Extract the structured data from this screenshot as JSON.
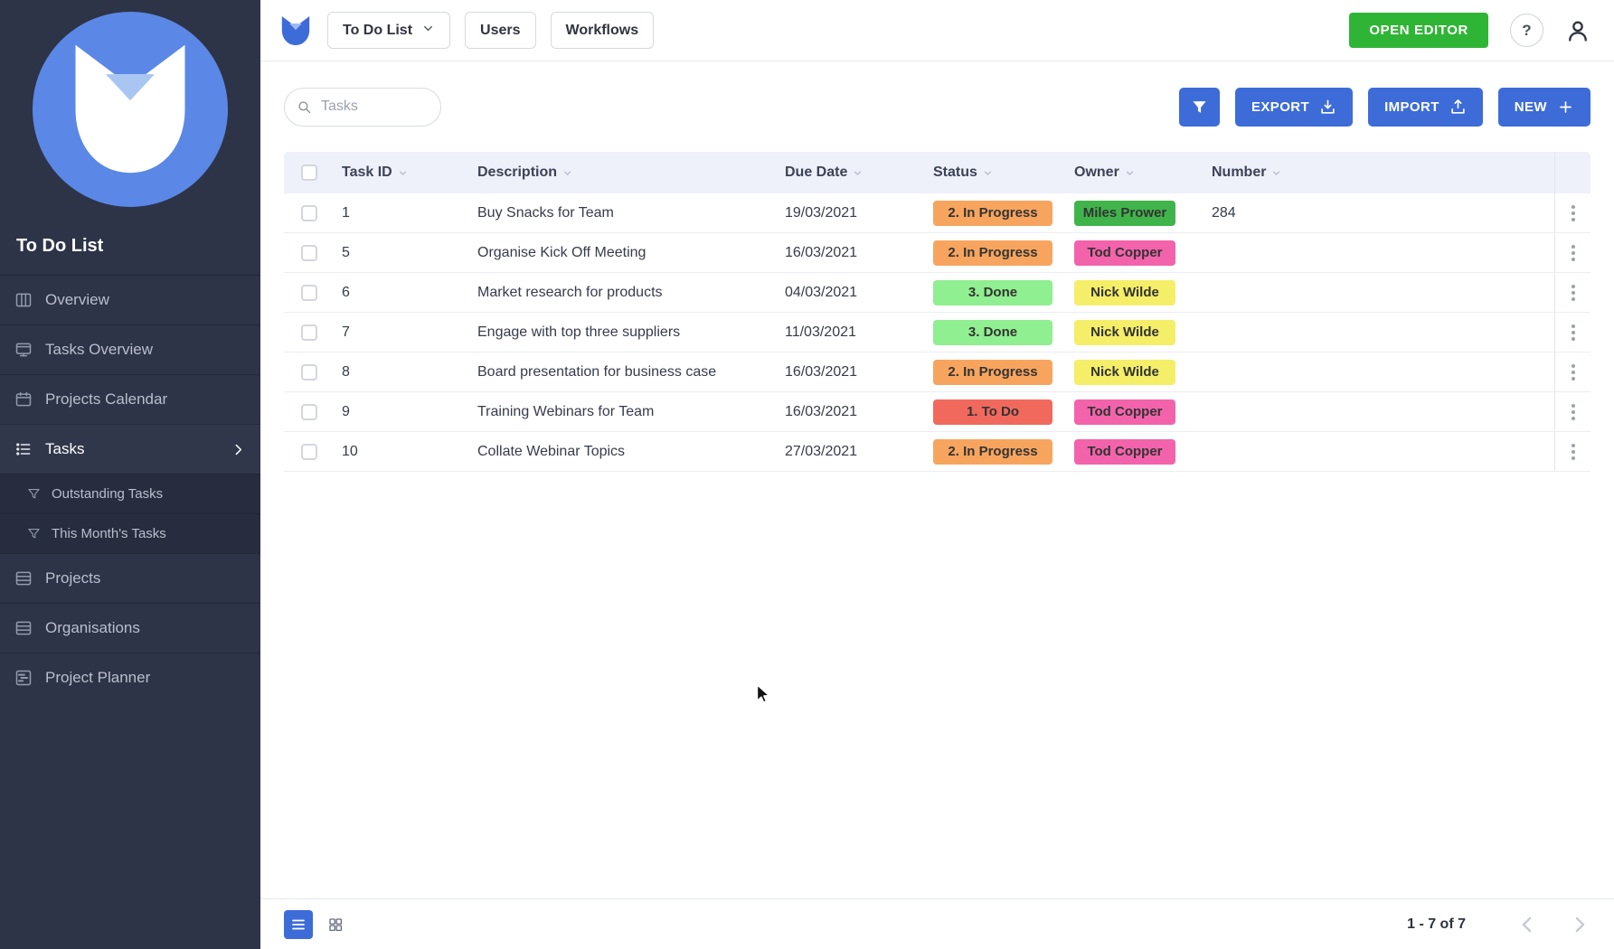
{
  "colors": {
    "accent": "#3d6cd8",
    "editor_green": "#2fb535",
    "sidebar_bg": "#2d3448",
    "table_header_bg": "#eef1fa",
    "status_in_progress": "#f7a55e",
    "status_done": "#90ef90",
    "status_to_do": "#f1695d",
    "owner_miles_prower": "#40b44b",
    "owner_tod_copper": "#f263ab",
    "owner_nick_wilde": "#f5ee68"
  },
  "sidebar": {
    "title": "To Do List",
    "items": [
      {
        "label": "Overview",
        "icon": "columns-icon"
      },
      {
        "label": "Tasks Overview",
        "icon": "presentation-icon"
      },
      {
        "label": "Projects Calendar",
        "icon": "calendar-icon"
      },
      {
        "label": "Tasks",
        "icon": "list-icon",
        "active": true
      },
      {
        "label": "Outstanding Tasks",
        "icon": "filter-icon",
        "sub": true
      },
      {
        "label": "This Month's Tasks",
        "icon": "filter-icon",
        "sub": true
      },
      {
        "label": "Projects",
        "icon": "table-icon"
      },
      {
        "label": "Organisations",
        "icon": "table-icon"
      },
      {
        "label": "Project Planner",
        "icon": "gantt-icon"
      }
    ]
  },
  "header": {
    "workspace_selector": "To Do List",
    "users_button": "Users",
    "workflows_button": "Workflows",
    "open_editor_button": "OPEN EDITOR",
    "help_button": "?"
  },
  "toolbar": {
    "search_placeholder": "Tasks",
    "export_button": "EXPORT",
    "import_button": "IMPORT",
    "new_button": "NEW"
  },
  "icons": {
    "search": "magnifier",
    "filter": "funnel",
    "export": "download-tray",
    "import": "upload-tray",
    "new": "plus",
    "help": "question-mark-circle",
    "user": "person-silhouette",
    "sort": "chevron-down",
    "row_menu": "vertical-kebab-dots",
    "list_view": "list-lines",
    "grid_view": "grid-squares",
    "prev_page": "chevron-left",
    "next_page": "chevron-right"
  },
  "table": {
    "columns": {
      "task_id": "Task ID",
      "description": "Description",
      "due_date": "Due Date",
      "status": "Status",
      "owner": "Owner",
      "number": "Number"
    },
    "rows": [
      {
        "task_id": "1",
        "description": "Buy Snacks for Team",
        "due_date": "19/03/2021",
        "status": "2. In Progress",
        "status_bg": "#f7a55e",
        "owner": "Miles Prower",
        "owner_bg": "#40b44b",
        "number": "284"
      },
      {
        "task_id": "5",
        "description": "Organise Kick Off Meeting",
        "due_date": "16/03/2021",
        "status": "2. In Progress",
        "status_bg": "#f7a55e",
        "owner": "Tod Copper",
        "owner_bg": "#f263ab",
        "number": ""
      },
      {
        "task_id": "6",
        "description": "Market research for products",
        "due_date": "04/03/2021",
        "status": "3. Done",
        "status_bg": "#90ef90",
        "owner": "Nick Wilde",
        "owner_bg": "#f5ee68",
        "number": ""
      },
      {
        "task_id": "7",
        "description": "Engage with top three suppliers",
        "due_date": "11/03/2021",
        "status": "3. Done",
        "status_bg": "#90ef90",
        "owner": "Nick Wilde",
        "owner_bg": "#f5ee68",
        "number": ""
      },
      {
        "task_id": "8",
        "description": "Board presentation for business case",
        "due_date": "16/03/2021",
        "status": "2. In Progress",
        "status_bg": "#f7a55e",
        "owner": "Nick Wilde",
        "owner_bg": "#f5ee68",
        "number": ""
      },
      {
        "task_id": "9",
        "description": "Training Webinars for Team",
        "due_date": "16/03/2021",
        "status": "1. To Do",
        "status_bg": "#f1695d",
        "owner": "Tod Copper",
        "owner_bg": "#f263ab",
        "number": ""
      },
      {
        "task_id": "10",
        "description": "Collate Webinar Topics",
        "due_date": "27/03/2021",
        "status": "2. In Progress",
        "status_bg": "#f7a55e",
        "owner": "Tod Copper",
        "owner_bg": "#f263ab",
        "number": ""
      }
    ]
  },
  "footer": {
    "range_label": "1 - 7 of 7"
  }
}
